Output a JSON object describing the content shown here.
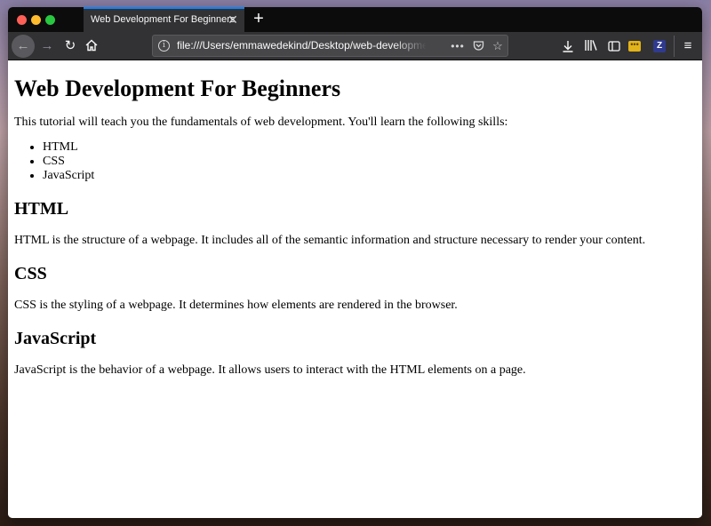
{
  "browser": {
    "tab_title": "Web Development For Beginners",
    "tab_close_glyph": "✕",
    "new_tab_glyph": "+",
    "url": "file:///Users/emmawedekind/Desktop/web-development-for-beginners.html",
    "icons": [
      "back-arrow-icon",
      "forward-arrow-icon",
      "reload-icon",
      "home-icon",
      "info-icon",
      "more-icon",
      "pocket-icon",
      "star-icon",
      "download-icon",
      "library-icon",
      "sidebar-icon",
      "extension-icon",
      "zotero-icon",
      "hamburger-menu-icon"
    ],
    "ext2_letter": "Z"
  },
  "page": {
    "title": "Web Development For Beginners",
    "intro": "This tutorial will teach you the fundamentals of web development. You'll learn the following skills:",
    "skills": [
      "HTML",
      "CSS",
      "JavaScript"
    ],
    "sections": [
      {
        "heading": "HTML",
        "text": "HTML is the structure of a webpage. It includes all of the semantic information and structure necessary to render your content."
      },
      {
        "heading": "CSS",
        "text": "CSS is the styling of a webpage. It determines how elements are rendered in the browser."
      },
      {
        "heading": "JavaScript",
        "text": "JavaScript is the behavior of a webpage. It allows users to interact with the HTML elements on a page."
      }
    ]
  }
}
